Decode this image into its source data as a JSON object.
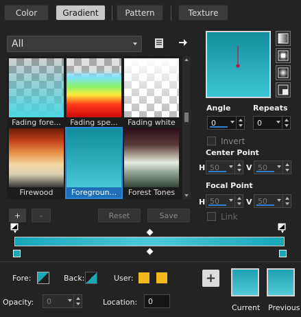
{
  "tabs": [
    "Color",
    "Gradient",
    "Pattern",
    "Texture"
  ],
  "library": {
    "category": "All",
    "items": [
      {
        "label": "Fading fore..."
      },
      {
        "label": "Fading spe..."
      },
      {
        "label": "Fading white"
      },
      {
        "label": "Firewood"
      },
      {
        "label": "Foregroun..."
      },
      {
        "label": "Forest Tones"
      }
    ]
  },
  "buttons": {
    "add": "+",
    "remove": "-",
    "reset": "Reset",
    "save": "Save"
  },
  "settings": {
    "angle_label": "Angle",
    "angle_value": "0",
    "repeats_label": "Repeats",
    "repeats_value": "0",
    "invert_label": "Invert",
    "center_label": "Center Point",
    "focal_label": "Focal Point",
    "h_label": "H",
    "v_label": "V",
    "center_h": "50",
    "center_v": "50",
    "focal_h": "50",
    "focal_v": "50",
    "link_label": "Link"
  },
  "footer": {
    "fore_label": "Fore:",
    "back_label": "Back:",
    "user_label": "User:",
    "opacity_label": "Opacity:",
    "opacity_value": "0",
    "location_label": "Location:",
    "location_value": "0",
    "current_label": "Current",
    "previous_label": "Previous"
  },
  "colors": {
    "accent": "#1e6fb8",
    "teal": "#1ca7b6",
    "user_yellow": "#f2b81c"
  },
  "icons": [
    "book-icon",
    "arrow-right-icon",
    "linear-style-icon",
    "radial-style-icon",
    "sunburst-style-icon",
    "rectangular-style-icon",
    "plus-icon"
  ]
}
